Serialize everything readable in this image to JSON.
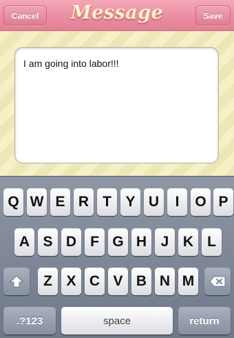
{
  "navbar": {
    "title": "Message",
    "cancel_label": "Cancel",
    "save_label": "Save"
  },
  "message": {
    "text": "I am going into labor!!!"
  },
  "keyboard": {
    "row1": [
      "Q",
      "W",
      "E",
      "R",
      "T",
      "Y",
      "U",
      "I",
      "O",
      "P"
    ],
    "row2": [
      "A",
      "S",
      "D",
      "F",
      "G",
      "H",
      "J",
      "K",
      "L"
    ],
    "row3": [
      "Z",
      "X",
      "C",
      "V",
      "B",
      "N",
      "M"
    ],
    "shift_icon": "shift-icon",
    "delete_icon": "delete-backspace-icon",
    "numbers_label": ".?123",
    "space_label": "space",
    "return_label": "return"
  },
  "colors": {
    "navbar_pink": "#ec8ea2",
    "title_cream": "#fbf2c8",
    "background_stripe": "#f5f0c6",
    "keyboard_gray": "#7f8898"
  }
}
